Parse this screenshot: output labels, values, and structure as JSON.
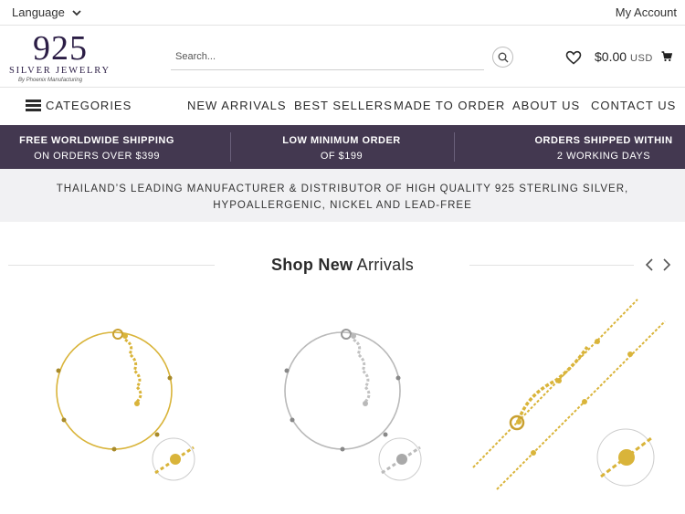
{
  "topbar": {
    "language_label": "Language",
    "account_label": "My Account"
  },
  "logo": {
    "number": "925",
    "subtitle": "SILVER JEWELRY",
    "by_line": "By Phoenix Manufacturing"
  },
  "search": {
    "placeholder": "Search..."
  },
  "cart": {
    "amount": "$0.00",
    "currency": "USD"
  },
  "nav": {
    "categories_label": "CATEGORIES",
    "links": [
      "NEW ARRIVALS",
      "BEST SELLERS",
      "MADE TO ORDER",
      "ABOUT US",
      "CONTACT US"
    ]
  },
  "promo": [
    {
      "bold": "FREE WORLDWIDE SHIPPING",
      "normal": "ON ORDERS OVER $399"
    },
    {
      "bold": "LOW MINIMUM ORDER",
      "normal": "OF $199"
    },
    {
      "bold": "ORDERS SHIPPED WITHIN",
      "normal": "2 WORKING DAYS"
    }
  ],
  "tagline": "THAILAND’S LEADING MANUFACTURER & DISTRIBUTOR OF HIGH QUALITY 925 STERLING SILVER, HYPOALLERGENIC, NICKEL AND LEAD-FREE",
  "section": {
    "title_bold": "Shop New",
    "title_normal": "Arrivals"
  },
  "colors": {
    "brand": "#433850",
    "logo": "#2b1d45",
    "gold": "#d9b43a",
    "silver": "#b9b9b9",
    "tagline_bg": "#f1f1f3"
  },
  "products": [
    {
      "icon": "gold-bracelet-image"
    },
    {
      "icon": "silver-bracelet-image"
    },
    {
      "icon": "gold-chain-image"
    }
  ]
}
